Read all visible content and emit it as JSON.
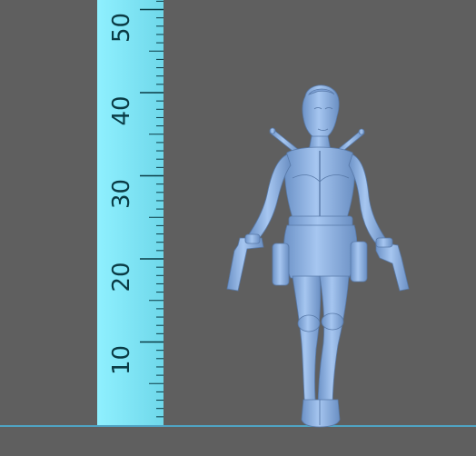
{
  "ruler": {
    "labels": [
      {
        "value": "10",
        "mm": 10
      },
      {
        "value": "20",
        "mm": 20
      },
      {
        "value": "30",
        "mm": 30
      },
      {
        "value": "40",
        "mm": 40
      },
      {
        "value": "50",
        "mm": 50
      }
    ],
    "unit_step_mm": 1,
    "visible_max_mm": 50
  },
  "colors": {
    "background": "#5f5f5f",
    "ruler": "#7fe6f5",
    "ruler_ink": "#0a3b45",
    "figure": "#8fb3e3",
    "ground_line": "#4fa4c4"
  },
  "figure": {
    "subject": "female-action-figure-with-pistols-icon"
  }
}
